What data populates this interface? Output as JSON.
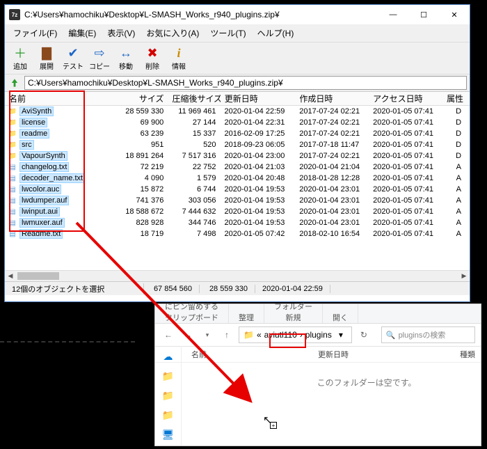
{
  "window1": {
    "title": "C:¥Users¥hamochiku¥Desktop¥L-SMASH_Works_r940_plugins.zip¥",
    "menu": {
      "file": "ファイル(F)",
      "edit": "編集(E)",
      "view": "表示(V)",
      "fav": "お気に入り(A)",
      "tool": "ツール(T)",
      "help": "ヘルプ(H)"
    },
    "toolbar": {
      "add": "追加",
      "extract": "展開",
      "test": "テスト",
      "copy": "コピー",
      "move": "移動",
      "delete": "削除",
      "info": "情報"
    },
    "address": "C:¥Users¥hamochiku¥Desktop¥L-SMASH_Works_r940_plugins.zip¥",
    "columns": {
      "name": "名前",
      "size": "サイズ",
      "psize": "圧縮後サイズ",
      "mod": "更新日時",
      "cre": "作成日時",
      "acc": "アクセス日時",
      "attr": "属性"
    },
    "rows": [
      {
        "t": "d",
        "n": "AviSynth",
        "s": "28 559 330",
        "p": "11 969 461",
        "m": "2020-01-04 22:59",
        "c": "2017-07-24 02:21",
        "a": "2020-01-05 07:41",
        "attr": "D"
      },
      {
        "t": "d",
        "n": "license",
        "s": "69 900",
        "p": "27 144",
        "m": "2020-01-04 22:31",
        "c": "2017-07-24 02:21",
        "a": "2020-01-05 07:41",
        "attr": "D"
      },
      {
        "t": "d",
        "n": "readme",
        "s": "63 239",
        "p": "15 337",
        "m": "2016-02-09 17:25",
        "c": "2017-07-24 02:21",
        "a": "2020-01-05 07:41",
        "attr": "D"
      },
      {
        "t": "d",
        "n": "src",
        "s": "951",
        "p": "520",
        "m": "2018-09-23 06:05",
        "c": "2017-07-18 11:47",
        "a": "2020-01-05 07:41",
        "attr": "D"
      },
      {
        "t": "d",
        "n": "VapourSynth",
        "s": "18 891 264",
        "p": "7 517 316",
        "m": "2020-01-04 23:00",
        "c": "2017-07-24 02:21",
        "a": "2020-01-05 07:41",
        "attr": "D"
      },
      {
        "t": "f",
        "n": "changelog.txt",
        "s": "72 219",
        "p": "22 752",
        "m": "2020-01-04 21:03",
        "c": "2020-01-04 21:04",
        "a": "2020-01-05 07:41",
        "attr": "A"
      },
      {
        "t": "f",
        "n": "decoder_name.txt",
        "s": "4 090",
        "p": "1 579",
        "m": "2020-01-04 20:48",
        "c": "2018-01-28 12:28",
        "a": "2020-01-05 07:41",
        "attr": "A"
      },
      {
        "t": "f",
        "n": "lwcolor.auc",
        "s": "15 872",
        "p": "6 744",
        "m": "2020-01-04 19:53",
        "c": "2020-01-04 23:01",
        "a": "2020-01-05 07:41",
        "attr": "A"
      },
      {
        "t": "f",
        "n": "lwdumper.auf",
        "s": "741 376",
        "p": "303 056",
        "m": "2020-01-04 19:53",
        "c": "2020-01-04 23:01",
        "a": "2020-01-05 07:41",
        "attr": "A"
      },
      {
        "t": "f",
        "n": "lwinput.aui",
        "s": "18 588 672",
        "p": "7 444 632",
        "m": "2020-01-04 19:53",
        "c": "2020-01-04 23:01",
        "a": "2020-01-05 07:41",
        "attr": "A"
      },
      {
        "t": "f",
        "n": "lwmuxer.auf",
        "s": "828 928",
        "p": "344 746",
        "m": "2020-01-04 19:53",
        "c": "2020-01-04 23:01",
        "a": "2020-01-05 07:41",
        "attr": "A"
      },
      {
        "t": "f",
        "n": "Readme.txt",
        "s": "18 719",
        "p": "7 498",
        "m": "2020-01-05 07:42",
        "c": "2018-02-10 16:54",
        "a": "2020-01-05 07:41",
        "attr": "A"
      }
    ],
    "status": {
      "sel": "12個のオブジェクトを選択",
      "s1": "67 854 560",
      "s2": "28 559 330",
      "s3": "2020-01-04 22:59"
    }
  },
  "window2": {
    "ribbon": {
      "pin": "にピン留めする",
      "clip": "クリップボード",
      "org": "整理",
      "folder": "フォルダー",
      "new": "新規",
      "open": "開く"
    },
    "crumb": {
      "p1": "aviutl110",
      "p2": "plugins"
    },
    "search_placeholder": "pluginsの検索",
    "hdr": {
      "name": "名前",
      "mod": "更新日時",
      "type": "種類"
    },
    "empty": "このフォルダーは空です。"
  },
  "icons": {
    "add": "#2e9e2e",
    "extract": "#1e66c9",
    "test": "#1e66c9",
    "copy": "#1e66c9",
    "move": "#1e66c9",
    "delete": "#d40000",
    "info": "#c98b00"
  }
}
